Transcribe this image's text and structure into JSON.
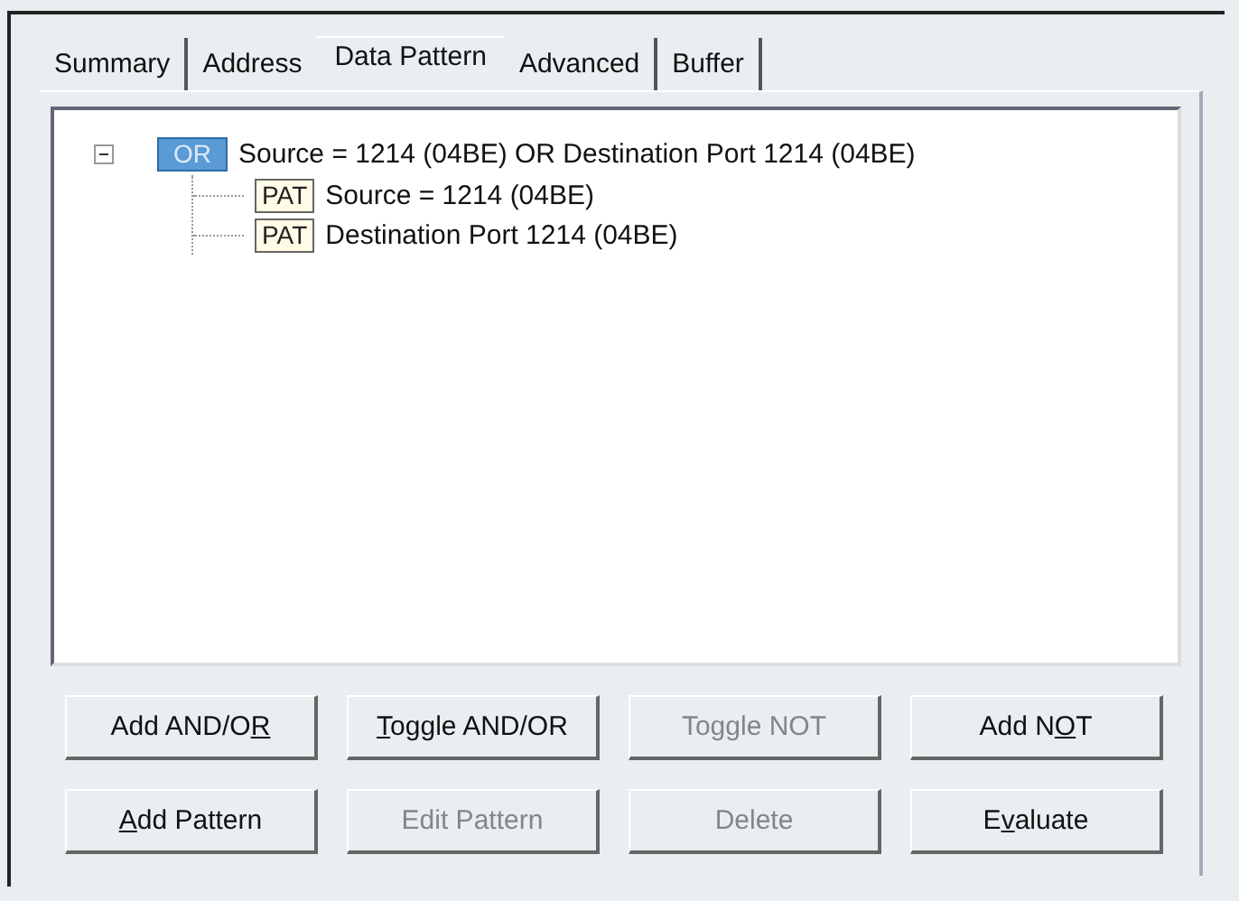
{
  "tabs": [
    {
      "label": "Summary",
      "selected": false
    },
    {
      "label": "Address",
      "selected": false
    },
    {
      "label": "Data Pattern",
      "selected": true
    },
    {
      "label": "Advanced",
      "selected": false
    },
    {
      "label": "Buffer",
      "selected": false
    }
  ],
  "tree": [
    {
      "tag": "OR",
      "kind": "operator",
      "text": "Source = 1214 (04BE) OR Destination Port 1214 (04BE)",
      "expanded": true,
      "children": [
        {
          "tag": "PAT",
          "kind": "pattern",
          "text": "Source = 1214 (04BE)"
        },
        {
          "tag": "PAT",
          "kind": "pattern",
          "text": "Destination Port 1214 (04BE)"
        }
      ]
    }
  ],
  "buttons": [
    [
      {
        "before": "Add AND/O",
        "key": "R",
        "disabled": false
      },
      {
        "key": "T",
        "after": "oggle AND/OR",
        "disabled": false
      },
      {
        "before": "Toggle NOT",
        "disabled": true
      },
      {
        "before": "Add N",
        "key": "O",
        "after": "T",
        "disabled": false
      }
    ],
    [
      {
        "key": "A",
        "after": "dd Pattern",
        "disabled": false
      },
      {
        "before": "Edit Pattern",
        "disabled": true
      },
      {
        "before": "Delete",
        "disabled": true
      },
      {
        "before": "E",
        "key": "v",
        "after": "aluate",
        "disabled": false
      }
    ]
  ]
}
